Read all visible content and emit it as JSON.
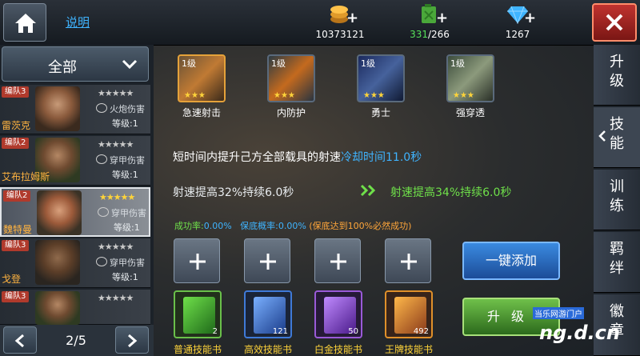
{
  "header": {
    "help_link": "说明",
    "resources": [
      {
        "icon": "gold-coins-icon",
        "value": "10373121"
      },
      {
        "icon": "fuel-can-icon",
        "value_current": "331",
        "value_max": "/266"
      },
      {
        "icon": "diamond-icon",
        "value": "1267"
      }
    ],
    "plus": "+"
  },
  "left_panel": {
    "filter_label": "全部",
    "units": [
      {
        "tag": "编队3",
        "stars": "★★★★★",
        "damage": "火炮伤害",
        "level": "等级:1",
        "name": "雷茨克"
      },
      {
        "tag": "编队2",
        "stars": "★★★★★",
        "damage": "穿甲伤害",
        "level": "等级:1",
        "name": "艾布拉姆斯"
      },
      {
        "tag": "编队2",
        "stars": "★★★★★",
        "damage": "穿甲伤害",
        "level": "等级:1",
        "name": "魏特曼"
      },
      {
        "tag": "编队3",
        "stars": "★★★★★",
        "damage": "穿甲伤害",
        "level": "等级:1",
        "name": "戈登"
      },
      {
        "tag": "编队3",
        "stars": "★★★★★",
        "damage": "",
        "level": "",
        "name": ""
      }
    ],
    "page": "2/5"
  },
  "skills": [
    {
      "level": "1级",
      "stars": "★★★",
      "name": "急速射击"
    },
    {
      "level": "1级",
      "stars": "★★★",
      "name": "内防护"
    },
    {
      "level": "1级",
      "stars": "★★★",
      "name": "勇士"
    },
    {
      "level": "1级",
      "stars": "★★★",
      "name": "强穿透"
    }
  ],
  "detail": {
    "description": "短时间内提升己方全部载具的射速",
    "cooldown": "冷却时间11.0秒",
    "current_effect": "射速提高32%持续6.0秒",
    "next_effect": "射速提高34%持续6.0秒",
    "success_rate_label": "成功率:",
    "success_rate_value": "0.00%",
    "guarantee_label": "保底概率:",
    "guarantee_value": "0.00%",
    "guarantee_note": "(保底达到100%必然成功)"
  },
  "books": [
    {
      "count": "2",
      "name": "普通技能书"
    },
    {
      "count": "121",
      "name": "高效技能书"
    },
    {
      "count": "50",
      "name": "白金技能书"
    },
    {
      "count": "492",
      "name": "王牌技能书"
    }
  ],
  "buttons": {
    "one_click_add": "一键添加",
    "upgrade": "升级"
  },
  "tabs": [
    "升级",
    "技能",
    "训练",
    "羁绊",
    "徽章"
  ],
  "watermark": {
    "line1": "当乐网游门户",
    "line2": "ng.d.cn"
  },
  "colors": {
    "accent_blue": "#3fb4ff",
    "green": "#6fe04a",
    "orange": "#ffa63a",
    "gold": "#ffd43a"
  }
}
